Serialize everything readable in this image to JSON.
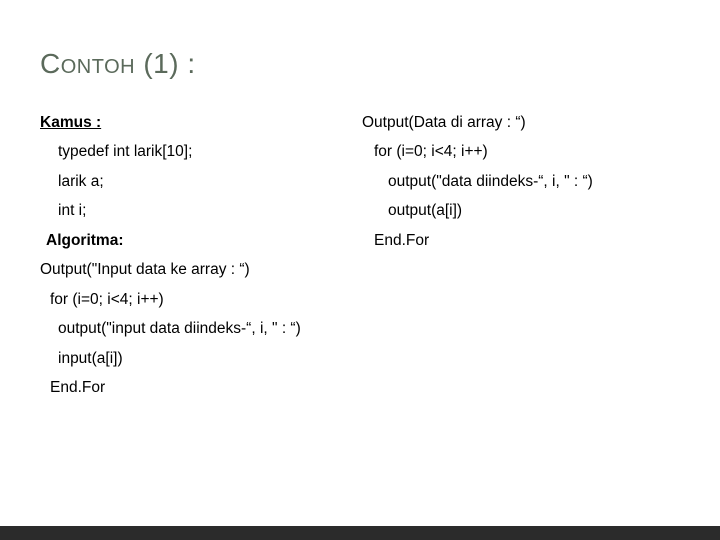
{
  "title": {
    "word": "Contoh",
    "suffix": " (1) :"
  },
  "left": {
    "kamus_label": "Kamus :",
    "typedef": "typedef  int larik[10];",
    "larik_a": "larik a;",
    "int_i": "int i;",
    "algoritma_label": "Algoritma:",
    "out_input_title": "Output(\"Input data ke array : “)",
    "for_line": "for (i=0; i<4; i++)",
    "out_input_idx": "output(\"input data diindeks-“, i, \" : “)",
    "input_ai": "input(a[i])",
    "endfor": "End.For"
  },
  "right": {
    "out_data_title": "Output(Data di array : “)",
    "for_line": "for (i=0; i<4; i++)",
    "out_data_idx": "output(\"data diindeks-“, i, \" : “)",
    "output_ai": "output(a[i])",
    "endfor": "End.For"
  }
}
